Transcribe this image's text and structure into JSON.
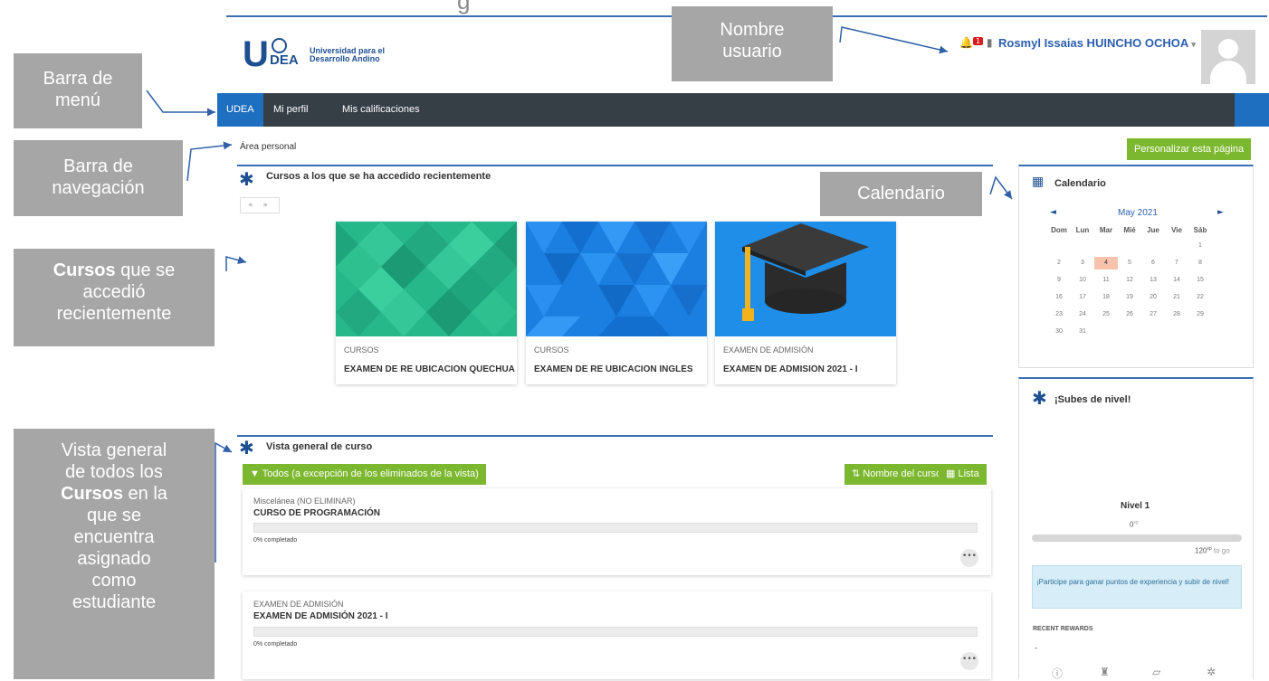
{
  "header": {
    "title_fragment": "g",
    "logo_letter": "U",
    "logo_sub": "DEA",
    "logo_line1": "Universidad para el",
    "logo_line2": "Desarrollo Andino",
    "notif_count": "1",
    "user_name": "Rosmyl Issaias HUINCHO OCHOA",
    "user_caret": "▾"
  },
  "nav": {
    "items": [
      "UDEA",
      "Mi perfil",
      "Mis calificaciones"
    ]
  },
  "breadcrumb": "Área personal",
  "customize_button": "Personalizar esta página",
  "recent": {
    "title": "Cursos a los que se ha accedido recientemente",
    "pager": "« »",
    "courses": [
      {
        "category": "CURSOS",
        "name": "EXAMEN DE RE UBICACIÓN QUECHUA"
      },
      {
        "category": "CURSOS",
        "name": "EXAMEN DE RE UBICACIÓN INGLÉS"
      },
      {
        "category": "EXAMEN DE ADMISIÓN",
        "name": "EXAMEN DE ADMISIÓN 2021 - I"
      }
    ]
  },
  "overview": {
    "title": "Vista general de curso",
    "filter_button": "Todos (a excepción de los eliminados de la vista)",
    "sort_button": "Nombre del curso",
    "view_button": "Lista",
    "courses": [
      {
        "category": "Miscelánea (NO ELIMINAR)",
        "name": "CURSO DE PROGRAMACIÓN",
        "progress": "0% completado",
        "progress_value": 0
      },
      {
        "category": "EXAMEN DE ADMISIÓN",
        "name": "EXAMEN DE ADMISIÓN 2021 - I",
        "progress": "0% completado",
        "progress_value": 0
      }
    ],
    "more": "•••"
  },
  "calendar": {
    "title": "Calendario",
    "month": "May 2021",
    "prev": "◄",
    "next": "►",
    "weekdays": [
      "Dom",
      "Lun",
      "Mar",
      "Mié",
      "Jue",
      "Vie",
      "Sáb"
    ],
    "first_weekday": 6,
    "days_in_month": 31,
    "today": 4
  },
  "level": {
    "title": "¡Subes de nivel!",
    "level_label": "Nivel 1",
    "xp": "0",
    "xp_unit": "xp",
    "to_go": "120",
    "to_go_suffix": "to go",
    "progress_value": 0,
    "info": "¡Participe para ganar puntos de experiencia y subir de nivel!",
    "rewards_title": "RECENT REWARDS",
    "rewards_empty": "-"
  },
  "annotations": {
    "nombre_usuario_1": "Nombre",
    "nombre_usuario_2": "usuario",
    "barra_menu_1": "Barra de",
    "barra_menu_2": "menú",
    "barra_nav_1": "Barra de",
    "barra_nav_2": "navegación",
    "calendario": "Calendario",
    "cursos_bold": "Cursos",
    "cursos_1": " que se",
    "cursos_2": "accedió",
    "cursos_3": "recientemente",
    "vista_1": "Vista general",
    "vista_2": "de todos los",
    "vista_bold": "Cursos",
    "vista_3": " en la",
    "vista_4": "que se",
    "vista_5": "encuentra",
    "vista_6": "asignado",
    "vista_7": "como",
    "vista_8": "estudiante"
  },
  "colors": {
    "nav_bg": "#363e46",
    "accent_blue": "#1f6fc0",
    "green": "#7cb82f",
    "callout_gray": "#a6a6a6"
  }
}
